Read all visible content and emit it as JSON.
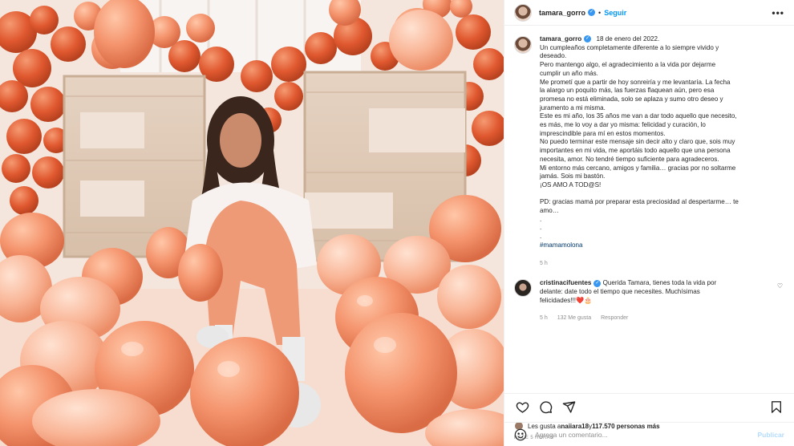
{
  "post": {
    "username": "tamara_gorro",
    "follow_label": "Seguir",
    "more_label": "•••",
    "caption_date": "18 de enero del 2022.",
    "caption_lines": [
      "Un cumpleaños completamente diferente a lo siempre vivido y",
      "deseado.",
      "Pero mantengo algo, el agradecimiento a la vida por dejarme",
      "cumplir un año más.",
      "Me prometí que a partir de hoy sonreiría y me levantaría. La fecha",
      "la alargo un poquito más, las fuerzas flaquean aún, pero esa",
      "promesa no está eliminada, solo se aplaza y sumo otro deseo y",
      "juramento a mi misma.",
      "Este es mi año, los 35 años me van a dar todo aquello que necesito,",
      "es más, me lo voy a dar yo misma: felicidad y curación, lo",
      "imprescindible para mí en estos momentos.",
      "No puedo terminar este mensaje sin decir alto y claro que, sois muy",
      "importantes en mi vida, me aportáis todo aquello que una persona",
      "necesita, amor. No tendré tiempo suficiente para agradeceros.",
      "Mi entorno más cercano, amigos y familia… gracias por no soltarme",
      "jamás. Sois mi bastón.",
      "¡OS AMO A TOD@S!",
      "",
      "PD: gracias mamá por preparar esta preciosidad al despertarme… te",
      "amo…",
      ".",
      ".",
      "."
    ],
    "hashtag": "#mamamolona",
    "caption_time": "5 h"
  },
  "comment": {
    "username": "cristinacifuentes",
    "text_lines": [
      "Querida Tamara, tienes toda la vida por",
      "delante: date todo el tiempo que necesites. Muchísimas",
      "felicidades!!!"
    ],
    "emojis": "❤️🎂",
    "time": "5 h",
    "likes": "132 Me gusta",
    "reply_label": "Responder"
  },
  "likes": {
    "prefix": "Les gusta a ",
    "user": "naiiara18",
    "middle": " y ",
    "count": "117.570 personas más"
  },
  "ago_label": "HACE 5 HORAS",
  "add_comment": {
    "placeholder": "Agrega un comentario...",
    "post_label": "Publicar"
  },
  "colors": {
    "accent": "#0095f6",
    "verified": "#3897f0",
    "balloon": "#f4936c",
    "like_red": "#ed4956"
  },
  "icons": [
    "verified-badge-icon",
    "more-options-icon",
    "heart-icon",
    "comment-icon",
    "share-icon",
    "bookmark-icon",
    "emoji-icon"
  ]
}
